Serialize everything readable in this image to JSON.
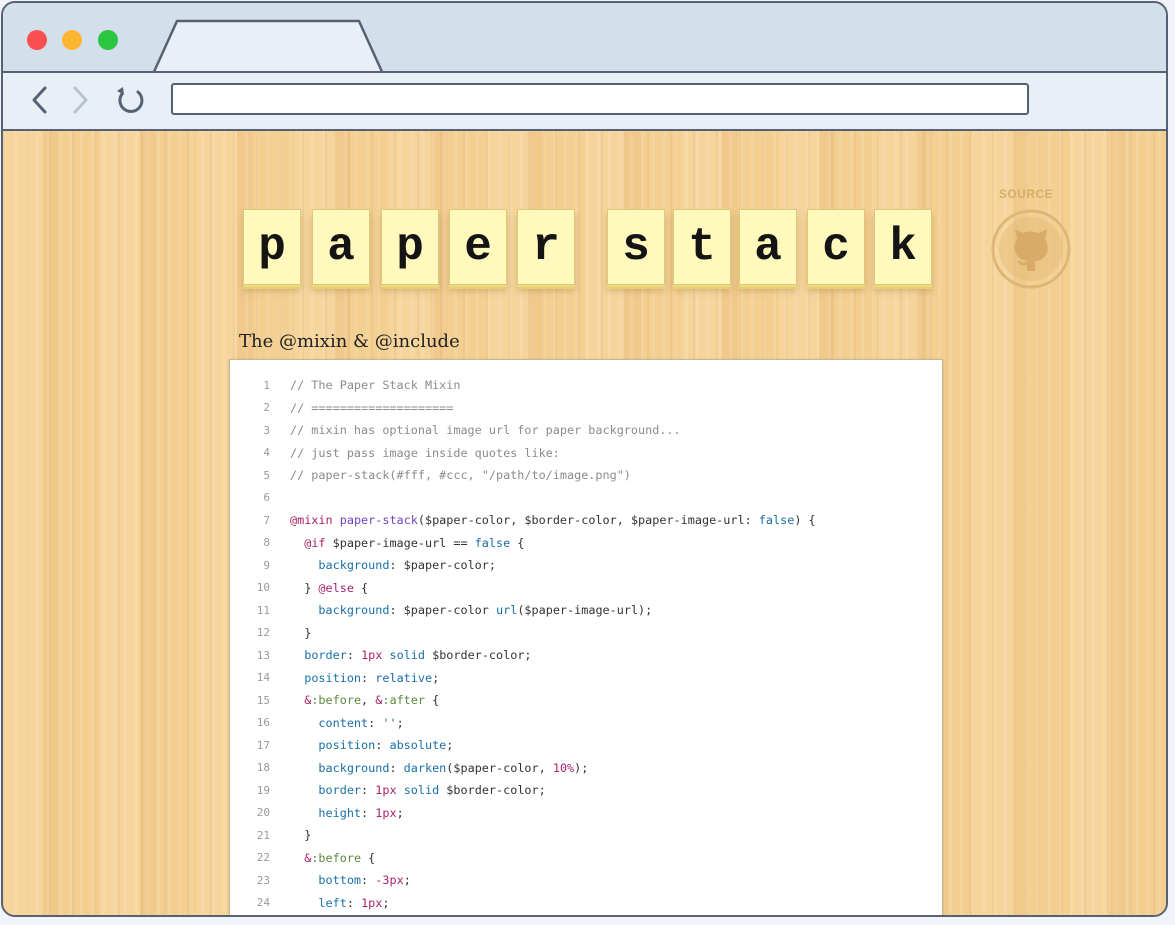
{
  "browser": {
    "window_buttons": [
      "close",
      "minimize",
      "maximize"
    ],
    "address_value": "",
    "icons": {
      "back": "chevron-left-icon",
      "forward": "chevron-right-icon",
      "reload": "reload-icon"
    }
  },
  "page": {
    "logo_letters": [
      "p",
      "a",
      "p",
      "e",
      "r",
      "s",
      "t",
      "a",
      "c",
      "k"
    ],
    "source_label": "SOURCE",
    "source_icon": "github-octocat-icon",
    "section_title": "The @mixin & @include"
  },
  "code": {
    "lines": [
      {
        "n": "1",
        "tokens": [
          [
            "comment",
            "// The Paper Stack Mixin"
          ]
        ]
      },
      {
        "n": "2",
        "tokens": [
          [
            "comment",
            "// ===================="
          ]
        ]
      },
      {
        "n": "3",
        "tokens": [
          [
            "comment",
            "// mixin has optional image url for paper background..."
          ]
        ]
      },
      {
        "n": "4",
        "tokens": [
          [
            "comment",
            "// just pass image inside quotes like:"
          ]
        ]
      },
      {
        "n": "5",
        "tokens": [
          [
            "comment",
            "// paper-stack(#fff, #ccc, \"/path/to/image.png\")"
          ]
        ]
      },
      {
        "n": "6",
        "tokens": []
      },
      {
        "n": "7",
        "tokens": [
          [
            "at",
            "@mixin"
          ],
          [
            "text",
            " "
          ],
          [
            "name",
            "paper-stack"
          ],
          [
            "text",
            "($paper-color, $border-color, $paper-image-url: "
          ],
          [
            "bool",
            "false"
          ],
          [
            "text",
            ") {"
          ]
        ]
      },
      {
        "n": "8",
        "tokens": [
          [
            "text",
            "  "
          ],
          [
            "at",
            "@if"
          ],
          [
            "text",
            " $paper-image-url == "
          ],
          [
            "bool",
            "false"
          ],
          [
            "text",
            " {"
          ]
        ]
      },
      {
        "n": "9",
        "tokens": [
          [
            "text",
            "    "
          ],
          [
            "prop",
            "background"
          ],
          [
            "text",
            ": $paper-color;"
          ]
        ]
      },
      {
        "n": "10",
        "tokens": [
          [
            "text",
            "  } "
          ],
          [
            "at",
            "@else"
          ],
          [
            "text",
            " {"
          ]
        ]
      },
      {
        "n": "11",
        "tokens": [
          [
            "text",
            "    "
          ],
          [
            "prop",
            "background"
          ],
          [
            "text",
            ": $paper-color "
          ],
          [
            "func",
            "url"
          ],
          [
            "text",
            "($paper-image-url);"
          ]
        ]
      },
      {
        "n": "12",
        "tokens": [
          [
            "text",
            "  }"
          ]
        ]
      },
      {
        "n": "13",
        "tokens": [
          [
            "text",
            "  "
          ],
          [
            "prop",
            "border"
          ],
          [
            "text",
            ": "
          ],
          [
            "num",
            "1px"
          ],
          [
            "text",
            " "
          ],
          [
            "value",
            "solid"
          ],
          [
            "text",
            " $border-color;"
          ]
        ]
      },
      {
        "n": "14",
        "tokens": [
          [
            "text",
            "  "
          ],
          [
            "prop",
            "position"
          ],
          [
            "text",
            ": "
          ],
          [
            "value",
            "relative"
          ],
          [
            "text",
            ";"
          ]
        ]
      },
      {
        "n": "15",
        "tokens": [
          [
            "text",
            "  "
          ],
          [
            "amp",
            "&"
          ],
          [
            "pseudo",
            ":before"
          ],
          [
            "text",
            ", "
          ],
          [
            "amp",
            "&"
          ],
          [
            "pseudo",
            ":after"
          ],
          [
            "text",
            " {"
          ]
        ]
      },
      {
        "n": "16",
        "tokens": [
          [
            "text",
            "    "
          ],
          [
            "prop",
            "content"
          ],
          [
            "text",
            ": "
          ],
          [
            "str",
            "''"
          ],
          [
            "text",
            ";"
          ]
        ]
      },
      {
        "n": "17",
        "tokens": [
          [
            "text",
            "    "
          ],
          [
            "prop",
            "position"
          ],
          [
            "text",
            ": "
          ],
          [
            "value",
            "absolute"
          ],
          [
            "text",
            ";"
          ]
        ]
      },
      {
        "n": "18",
        "tokens": [
          [
            "text",
            "    "
          ],
          [
            "prop",
            "background"
          ],
          [
            "text",
            ": "
          ],
          [
            "func",
            "darken"
          ],
          [
            "text",
            "($paper-color, "
          ],
          [
            "num",
            "10%"
          ],
          [
            "text",
            ");"
          ]
        ]
      },
      {
        "n": "19",
        "tokens": [
          [
            "text",
            "    "
          ],
          [
            "prop",
            "border"
          ],
          [
            "text",
            ": "
          ],
          [
            "num",
            "1px"
          ],
          [
            "text",
            " "
          ],
          [
            "value",
            "solid"
          ],
          [
            "text",
            " $border-color;"
          ]
        ]
      },
      {
        "n": "20",
        "tokens": [
          [
            "text",
            "    "
          ],
          [
            "prop",
            "height"
          ],
          [
            "text",
            ": "
          ],
          [
            "num",
            "1px"
          ],
          [
            "text",
            ";"
          ]
        ]
      },
      {
        "n": "21",
        "tokens": [
          [
            "text",
            "  }"
          ]
        ]
      },
      {
        "n": "22",
        "tokens": [
          [
            "text",
            "  "
          ],
          [
            "amp",
            "&"
          ],
          [
            "pseudo",
            ":before"
          ],
          [
            "text",
            " {"
          ]
        ]
      },
      {
        "n": "23",
        "tokens": [
          [
            "text",
            "    "
          ],
          [
            "prop",
            "bottom"
          ],
          [
            "text",
            ": "
          ],
          [
            "num",
            "-3px"
          ],
          [
            "text",
            ";"
          ]
        ]
      },
      {
        "n": "24",
        "tokens": [
          [
            "text",
            "    "
          ],
          [
            "prop",
            "left"
          ],
          [
            "text",
            ": "
          ],
          [
            "num",
            "1px"
          ],
          [
            "text",
            ";"
          ]
        ]
      }
    ]
  },
  "colors": {
    "window_close": "#fb4f4f",
    "window_minimize": "#fdb632",
    "window_maximize": "#2cc53f",
    "chrome_border": "#566273",
    "tile_paper": "#fff9bd",
    "wood": "#f3cf92"
  }
}
